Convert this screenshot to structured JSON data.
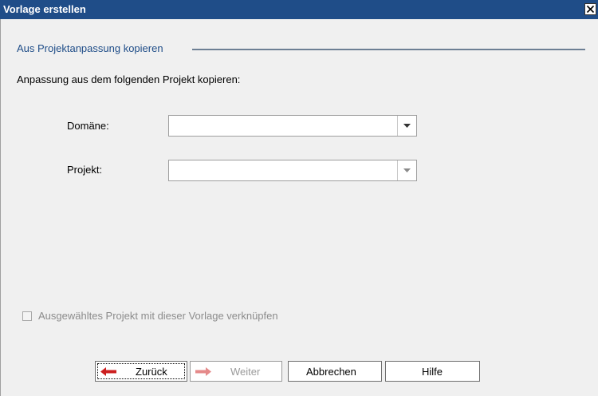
{
  "dialog": {
    "title": "Vorlage erstellen",
    "close_glyph": "x"
  },
  "section": {
    "title": "Aus Projektanpassung kopieren"
  },
  "instruction": "Anpassung aus dem folgenden Projekt kopieren:",
  "fields": {
    "domain": {
      "label": "Domäne:",
      "value": ""
    },
    "project": {
      "label": "Projekt:",
      "value": ""
    }
  },
  "link_checkbox": {
    "label": "Ausgewähltes Projekt mit dieser Vorlage verknüpfen",
    "checked": false,
    "enabled": false
  },
  "buttons": {
    "back": {
      "label": "Zurück",
      "icon": "arrow-left-icon",
      "icon_color": "#cc1f1f"
    },
    "next": {
      "label": "Weiter",
      "icon": "arrow-right-icon",
      "icon_color": "#e58a8a",
      "enabled": false
    },
    "cancel": {
      "label": "Abbrechen"
    },
    "help": {
      "label": "Hilfe"
    }
  },
  "colors": {
    "titlebar": "#1f4d88",
    "section_title": "#1f4d88",
    "background": "#f0f0f0"
  }
}
